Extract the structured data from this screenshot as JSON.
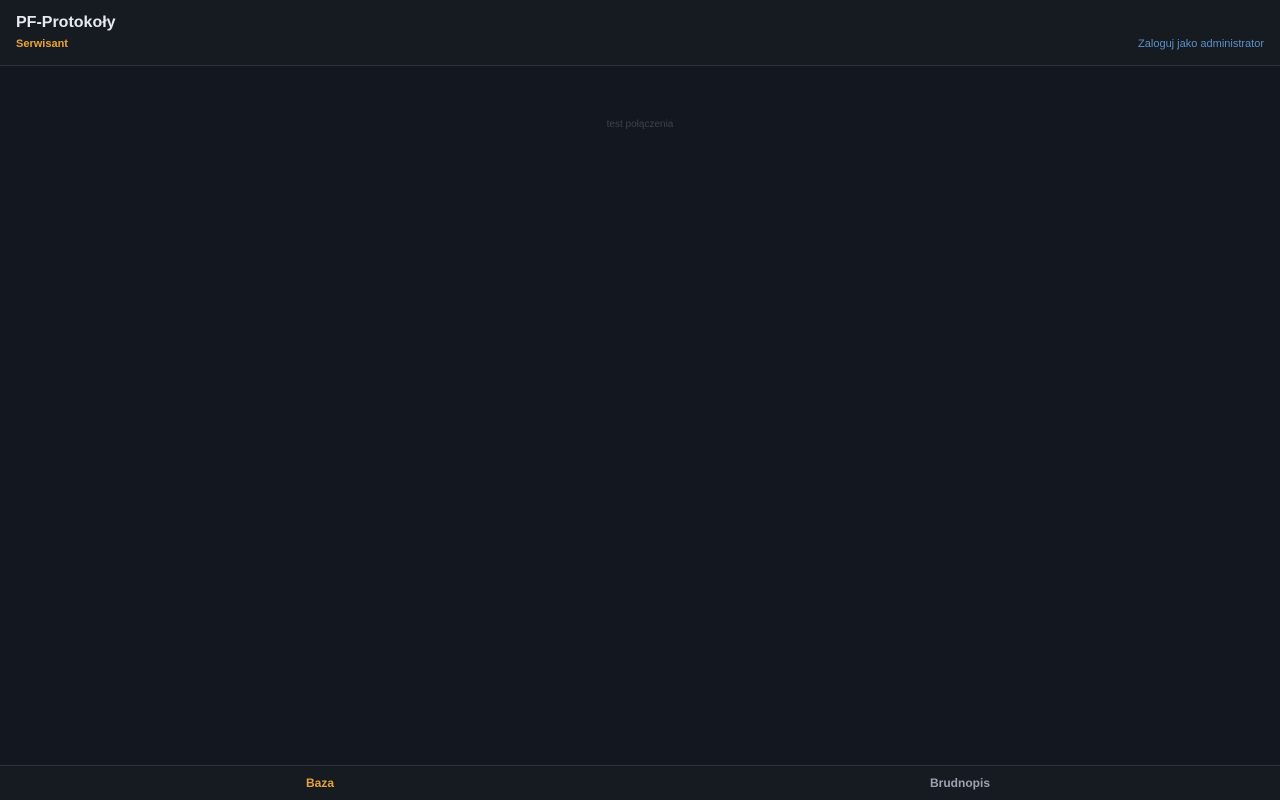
{
  "header": {
    "title": "PF-Protokoły",
    "role": "Serwisant",
    "admin_login_label": "Zaloguj jako administrator"
  },
  "main": {
    "test_connection_label": "test połączenia"
  },
  "bottom_nav": {
    "tabs": [
      {
        "label": "Baza",
        "active": true
      },
      {
        "label": "Brudnopis",
        "active": false
      }
    ]
  },
  "colors": {
    "background": "#131820",
    "accent": "#e8a23a",
    "link": "#5b8fc7"
  }
}
